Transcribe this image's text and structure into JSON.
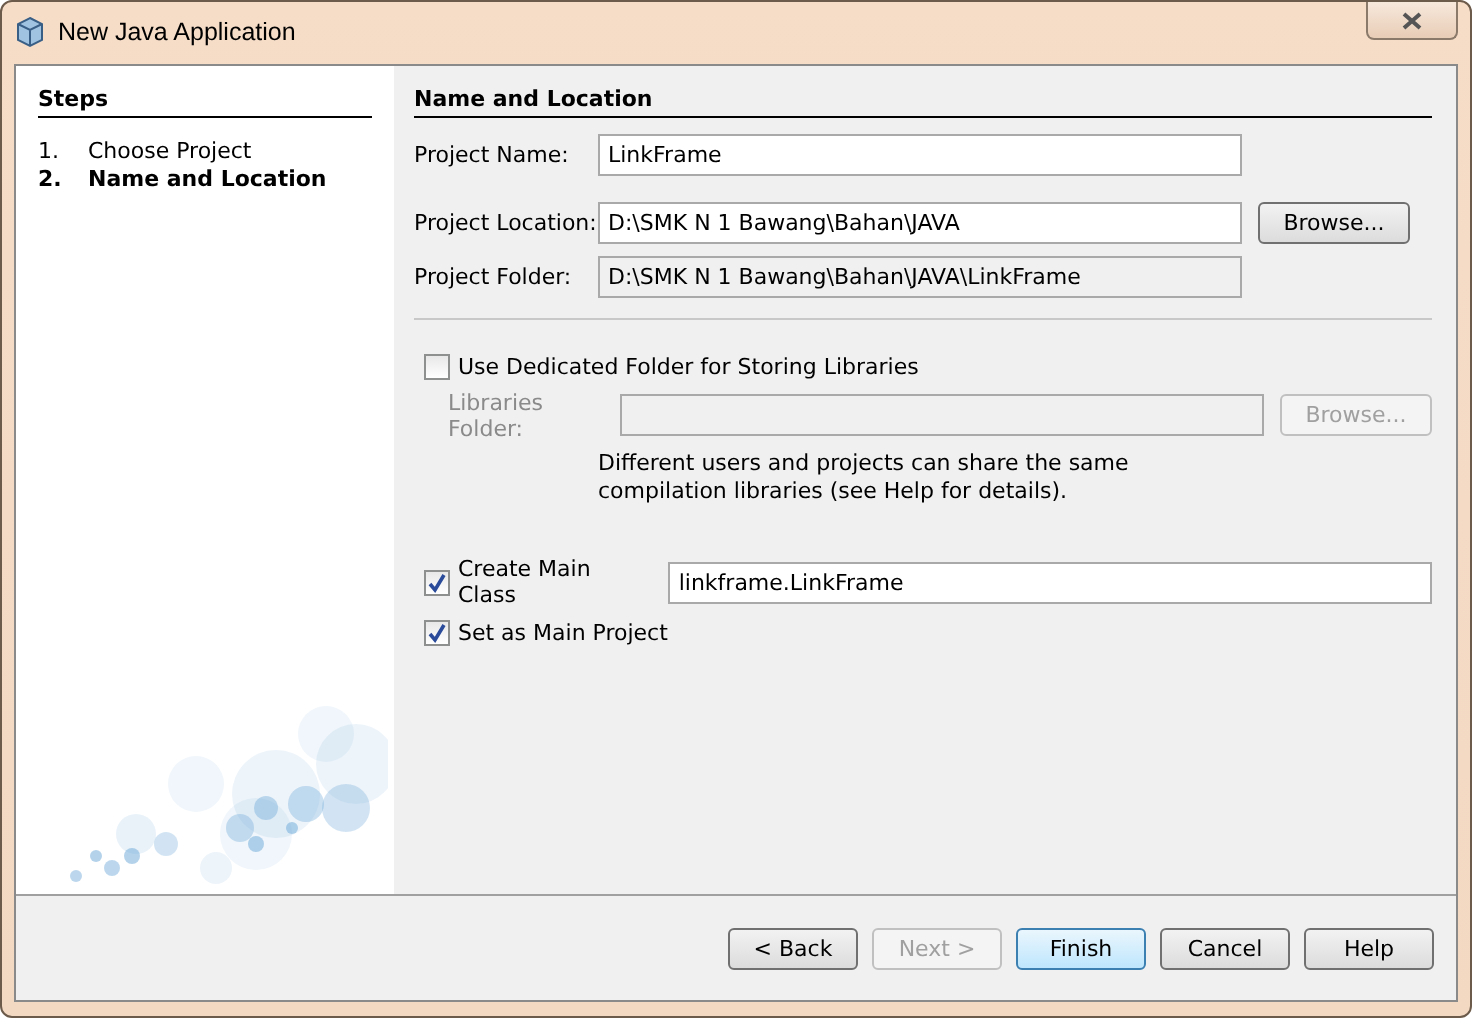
{
  "window": {
    "title": "New Java Application"
  },
  "steps": {
    "title": "Steps",
    "items": [
      {
        "number": "1.",
        "label": "Choose Project",
        "selected": false
      },
      {
        "number": "2.",
        "label": "Name and Location",
        "selected": true
      }
    ]
  },
  "panel": {
    "title": "Name and Location",
    "fields": [
      {
        "label": "Project Name:",
        "value": "LinkFrame",
        "readonly": false
      },
      {
        "label": "Project Location:",
        "value": "D:\\SMK N 1 Bawang\\Bahan\\JAVA",
        "readonly": false,
        "button": "Browse..."
      },
      {
        "label": "Project Folder:",
        "value": "D:\\SMK N 1 Bawang\\Bahan\\JAVA\\LinkFrame",
        "readonly": true
      }
    ],
    "dedicated": {
      "label": "Use Dedicated Folder for Storing Libraries",
      "checked": false
    },
    "libraries": {
      "label": "Libraries Folder:",
      "button": "Browse...",
      "disabled": true
    },
    "note": "Different users and projects can share the same compilation libraries (see Help for details).",
    "main_class": {
      "label": "Create Main Class",
      "checked": true,
      "value": "linkframe.LinkFrame"
    },
    "main_project": {
      "label": "Set as Main Project",
      "checked": true
    }
  },
  "buttons": [
    {
      "label": "< Back",
      "disabled": false,
      "default": false
    },
    {
      "label": "Next >",
      "disabled": true,
      "default": false
    },
    {
      "label": "Finish",
      "disabled": false,
      "default": true
    },
    {
      "label": "Cancel",
      "disabled": false,
      "default": false
    },
    {
      "label": "Help",
      "disabled": false,
      "default": false
    }
  ]
}
